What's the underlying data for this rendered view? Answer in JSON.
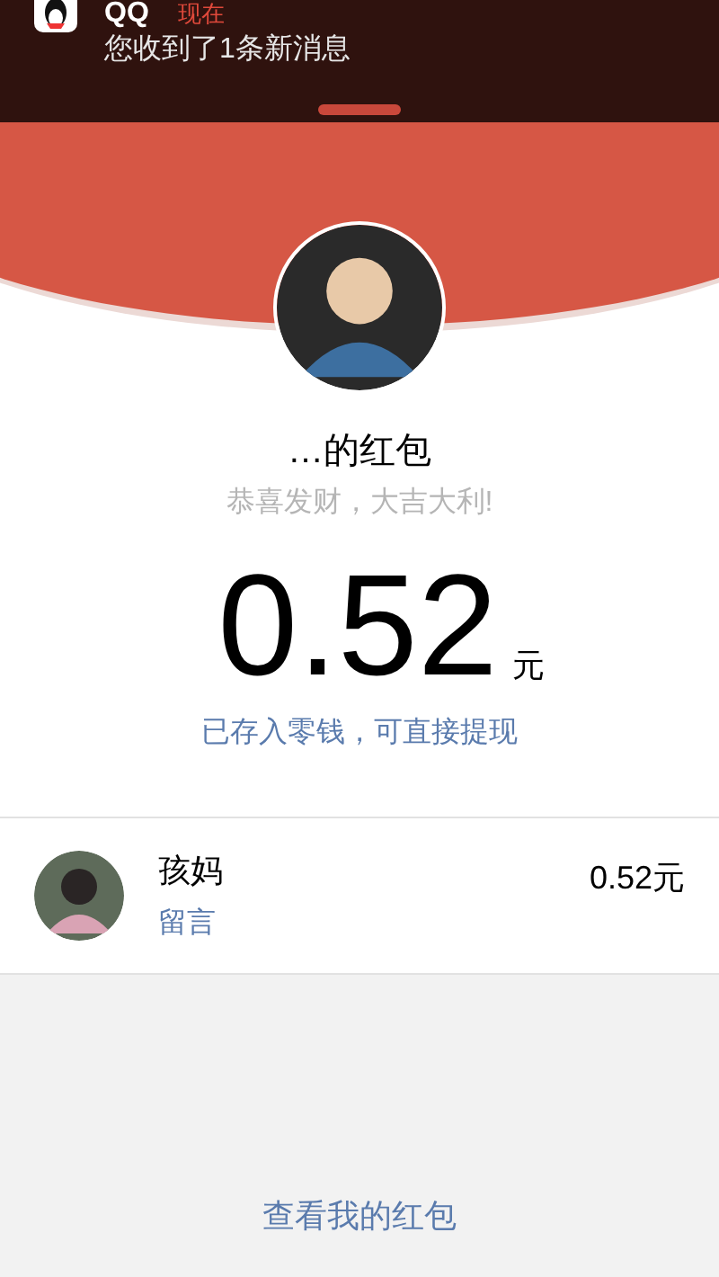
{
  "notification": {
    "app": "QQ",
    "time": "现在",
    "message": "您收到了1条新消息"
  },
  "packet": {
    "title": "…的红包",
    "greeting": "恭喜发财，大吉大利!",
    "amount": "0.52",
    "unit": "元",
    "note": "已存入零钱，可直接提现"
  },
  "receivers": [
    {
      "name": "孩妈",
      "action": "留言",
      "amount": "0.52元"
    }
  ],
  "footer_link": "查看我的红包"
}
